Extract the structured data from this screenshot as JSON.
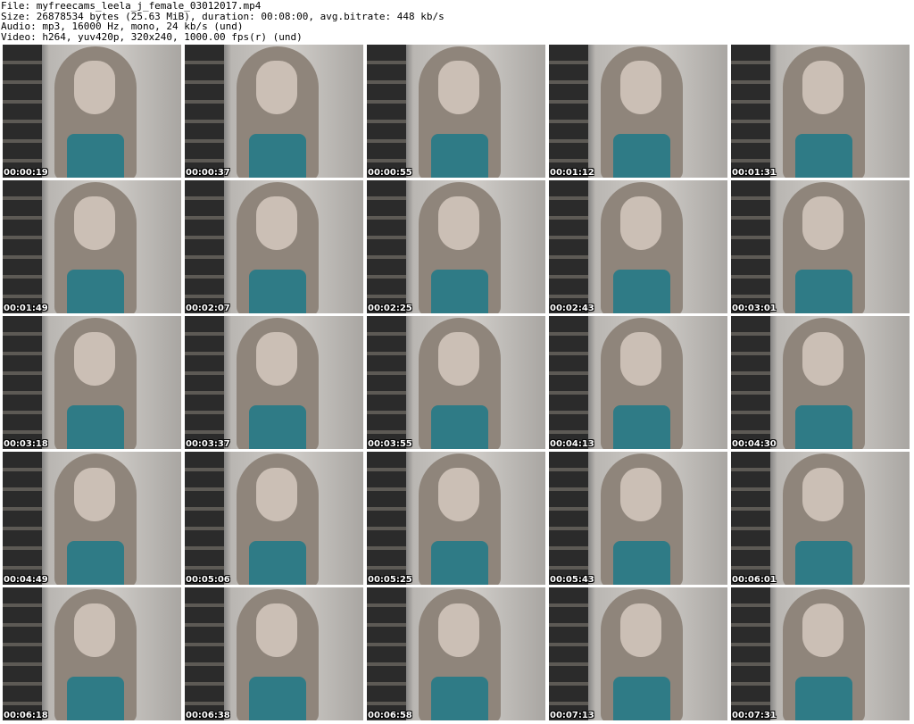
{
  "header": {
    "file": "File: myfreecams_leela_j_female_03012017.mp4",
    "size": "Size: 26878534 bytes (25.63 MiB), duration: 00:08:00, avg.bitrate: 448 kb/s",
    "audio": "Audio: mp3, 16000 Hz, mono, 24 kb/s (und)",
    "video": "Video: h264, yuv420p, 320x240, 1000.00 fps(r) (und)"
  },
  "thumbnails": [
    {
      "timestamp": "00:00:19"
    },
    {
      "timestamp": "00:00:37"
    },
    {
      "timestamp": "00:00:55"
    },
    {
      "timestamp": "00:01:12"
    },
    {
      "timestamp": "00:01:31"
    },
    {
      "timestamp": "00:01:49"
    },
    {
      "timestamp": "00:02:07"
    },
    {
      "timestamp": "00:02:25"
    },
    {
      "timestamp": "00:02:43"
    },
    {
      "timestamp": "00:03:01"
    },
    {
      "timestamp": "00:03:18"
    },
    {
      "timestamp": "00:03:37"
    },
    {
      "timestamp": "00:03:55"
    },
    {
      "timestamp": "00:04:13"
    },
    {
      "timestamp": "00:04:30"
    },
    {
      "timestamp": "00:04:49"
    },
    {
      "timestamp": "00:05:06"
    },
    {
      "timestamp": "00:05:25"
    },
    {
      "timestamp": "00:05:43"
    },
    {
      "timestamp": "00:06:01"
    },
    {
      "timestamp": "00:06:18"
    },
    {
      "timestamp": "00:06:38"
    },
    {
      "timestamp": "00:06:58"
    },
    {
      "timestamp": "00:07:13"
    },
    {
      "timestamp": "00:07:31"
    }
  ]
}
